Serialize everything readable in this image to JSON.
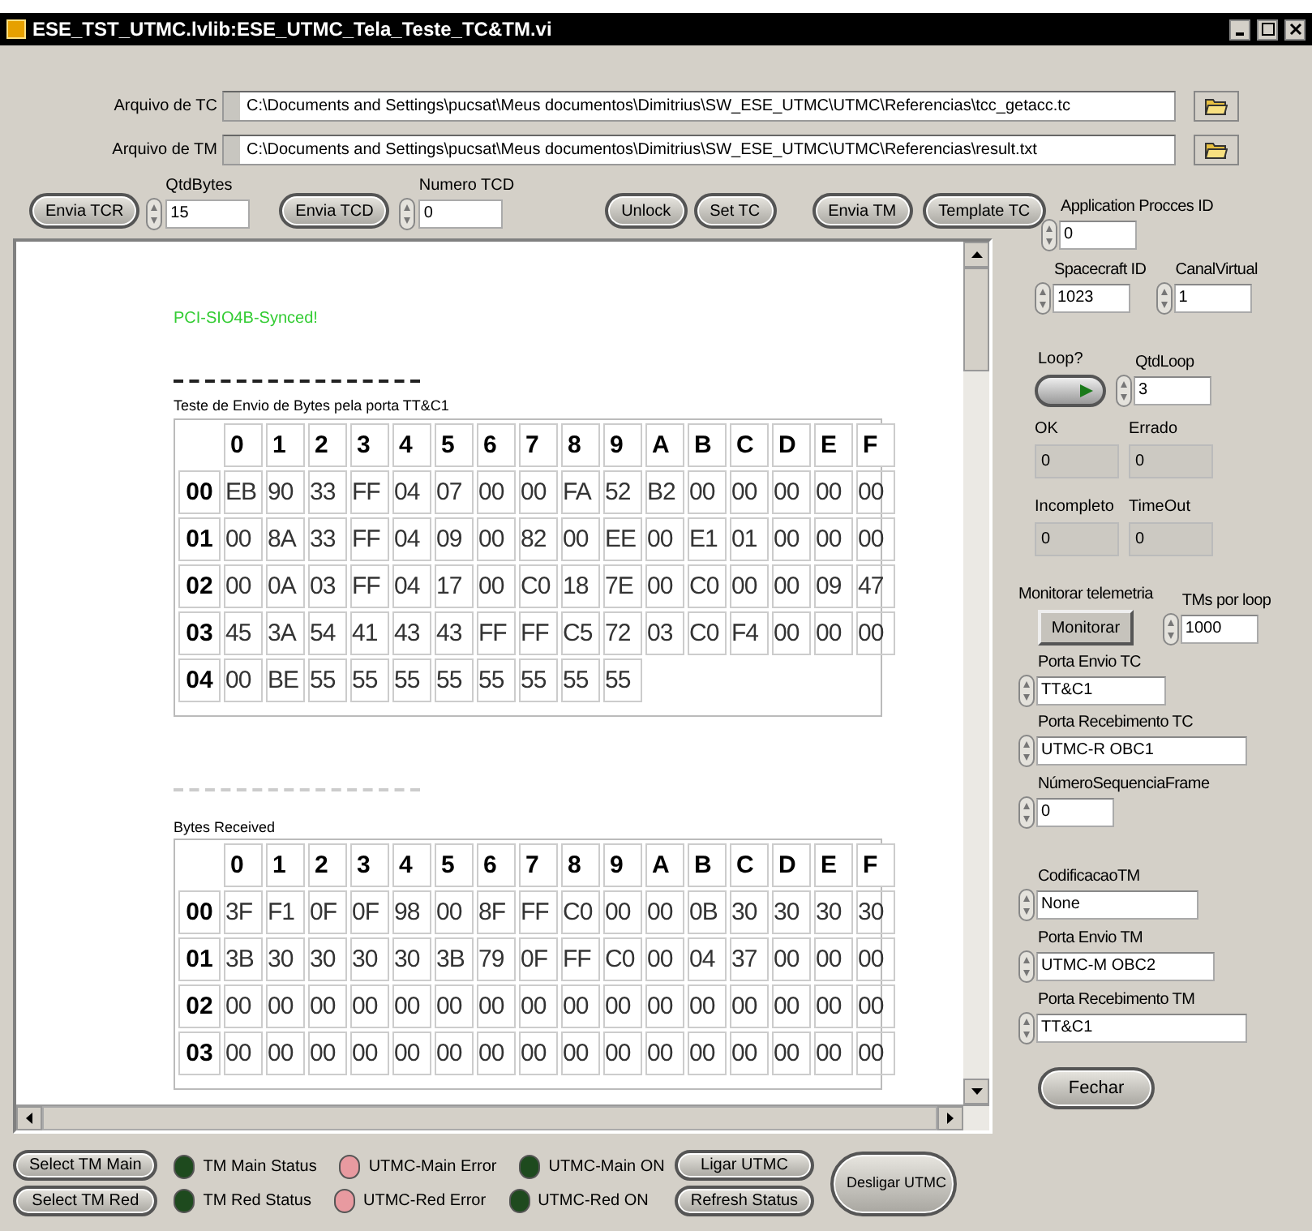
{
  "window": {
    "title": "ESE_TST_UTMC.lvlib:ESE_UTMC_Tela_Teste_TC&TM.vi"
  },
  "files": [
    {
      "label": "Arquivo de TC",
      "path": "C:\\Documents and Settings\\pucsat\\Meus documentos\\Dimitrius\\SW_ESE_UTMC\\UTMC\\Referencias\\tcc_getacc.tc"
    },
    {
      "label": "Arquivo de TM",
      "path": "C:\\Documents and Settings\\pucsat\\Meus documentos\\Dimitrius\\SW_ESE_UTMC\\UTMC\\Referencias\\result.txt"
    }
  ],
  "toolbar": [
    {
      "kind": "button",
      "label": "Envia TCR"
    },
    {
      "kind": "numeric",
      "label": "QtdBytes",
      "value": "15"
    },
    {
      "kind": "button",
      "label": "Envia TCD"
    },
    {
      "kind": "numeric",
      "label": "Numero TCD",
      "value": "0"
    },
    {
      "kind": "button",
      "label": "Unlock"
    },
    {
      "kind": "button",
      "label": "Set TC"
    },
    {
      "kind": "button",
      "label": "Envia TM"
    },
    {
      "kind": "button",
      "label": "Template TC"
    }
  ],
  "report": {
    "status_text": "PCI-SIO4B-Synced!",
    "sections": [
      {
        "title": "Teste de Envio de Bytes pela porta TT&C1",
        "columns": [
          "0",
          "1",
          "2",
          "3",
          "4",
          "5",
          "6",
          "7",
          "8",
          "9",
          "A",
          "B",
          "C",
          "D",
          "E",
          "F"
        ],
        "rows": [
          {
            "address": "00",
            "cells": [
              "EB",
              "90",
              "33",
              "FF",
              "04",
              "07",
              "00",
              "00",
              "FA",
              "52",
              "B2",
              "00",
              "00",
              "00",
              "00",
              "00"
            ]
          },
          {
            "address": "01",
            "cells": [
              "00",
              "8A",
              "33",
              "FF",
              "04",
              "09",
              "00",
              "82",
              "00",
              "EE",
              "00",
              "E1",
              "01",
              "00",
              "00",
              "00"
            ]
          },
          {
            "address": "02",
            "cells": [
              "00",
              "0A",
              "03",
              "FF",
              "04",
              "17",
              "00",
              "C0",
              "18",
              "7E",
              "00",
              "C0",
              "00",
              "00",
              "09",
              "47"
            ]
          },
          {
            "address": "03",
            "cells": [
              "45",
              "3A",
              "54",
              "41",
              "43",
              "43",
              "FF",
              "FF",
              "C5",
              "72",
              "03",
              "C0",
              "F4",
              "00",
              "00",
              "00"
            ]
          },
          {
            "address": "04",
            "cells": [
              "00",
              "BE",
              "55",
              "55",
              "55",
              "55",
              "55",
              "55",
              "55",
              "55"
            ]
          }
        ]
      },
      {
        "title": "Bytes Received",
        "columns": [
          "0",
          "1",
          "2",
          "3",
          "4",
          "5",
          "6",
          "7",
          "8",
          "9",
          "A",
          "B",
          "C",
          "D",
          "E",
          "F"
        ],
        "rows": [
          {
            "address": "00",
            "cells": [
              "3F",
              "F1",
              "0F",
              "0F",
              "98",
              "00",
              "8F",
              "FF",
              "C0",
              "00",
              "00",
              "0B",
              "30",
              "30",
              "30",
              "30"
            ]
          },
          {
            "address": "01",
            "cells": [
              "3B",
              "30",
              "30",
              "30",
              "30",
              "3B",
              "79",
              "0F",
              "FF",
              "C0",
              "00",
              "04",
              "37",
              "00",
              "00",
              "00"
            ]
          },
          {
            "address": "02",
            "cells": [
              "00",
              "00",
              "00",
              "00",
              "00",
              "00",
              "00",
              "00",
              "00",
              "00",
              "00",
              "00",
              "00",
              "00",
              "00",
              "00"
            ]
          },
          {
            "address": "03",
            "cells": [
              "00",
              "00",
              "00",
              "00",
              "00",
              "00",
              "00",
              "00",
              "00",
              "00",
              "00",
              "00",
              "00",
              "00",
              "00",
              "00"
            ]
          }
        ]
      }
    ]
  },
  "side_panel": [
    [
      {
        "kind": "numeric",
        "label": "Application Procces ID",
        "value": "0"
      }
    ],
    [
      {
        "kind": "numeric",
        "label": "Spacecraft ID",
        "value": "1023"
      },
      {
        "kind": "numeric",
        "label": "CanalVirtual",
        "value": "1"
      }
    ],
    [
      {
        "kind": "toggle",
        "label": "Loop?",
        "on": true
      },
      {
        "kind": "numeric",
        "label": "QtdLoop",
        "value": "3"
      }
    ],
    [
      {
        "kind": "indicator",
        "label": "OK",
        "value": "0"
      },
      {
        "kind": "indicator",
        "label": "Errado",
        "value": "0"
      }
    ],
    [
      {
        "kind": "indicator",
        "label": "Incompleto",
        "value": "0"
      },
      {
        "kind": "indicator",
        "label": "TimeOut",
        "value": "0"
      }
    ],
    [
      {
        "kind": "button",
        "label": "Monitorar telemetria",
        "button": "Monitorar"
      },
      {
        "kind": "numeric",
        "label": "TMs por loop",
        "value": "1000"
      }
    ],
    [
      {
        "kind": "ring",
        "label": "Porta Envio TC",
        "value": "TT&C1"
      }
    ],
    [
      {
        "kind": "ring",
        "label": "Porta Recebimento TC",
        "value": "UTMC-R OBC1"
      }
    ],
    [
      {
        "kind": "numeric",
        "label": "NúmeroSequenciaFrame",
        "value": "0"
      }
    ],
    [
      {
        "kind": "ring",
        "label": "CodificacaoTM",
        "value": "None"
      }
    ],
    [
      {
        "kind": "ring",
        "label": "Porta Envio TM",
        "value": "UTMC-M OBC2"
      }
    ],
    [
      {
        "kind": "ring",
        "label": "Porta Recebimento TM",
        "value": "TT&C1"
      }
    ]
  ],
  "close_button": "Fechar",
  "status_bar": {
    "select_buttons": [
      "Select TM Main",
      "Select TM Red"
    ],
    "leds": [
      [
        {
          "label": "TM Main Status",
          "color": "#1e4a1e"
        },
        {
          "label": "UTMC-Main Error",
          "color": "#e89aa0"
        },
        {
          "label": "UTMC-Main ON",
          "color": "#1e4a1e"
        }
      ],
      [
        {
          "label": "TM Red Status",
          "color": "#1e4a1e"
        },
        {
          "label": "UTMC-Red Error",
          "color": "#e89aa0"
        },
        {
          "label": "UTMC-Red ON",
          "color": "#1e4a1e"
        }
      ]
    ],
    "action_buttons": [
      "Ligar UTMC",
      "Refresh Status"
    ],
    "off_button": "Desligar UTMC"
  }
}
